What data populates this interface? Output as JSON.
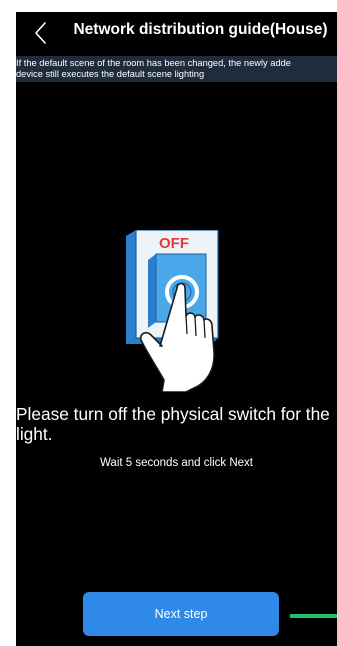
{
  "header": {
    "title": "Network distribution guide(House)",
    "back_icon": "chevron-left-icon"
  },
  "notice": {
    "line1": "If the default scene of the room has been changed, the newly adde",
    "line2": "device still executes the default scene lighting"
  },
  "illustration": {
    "switch_label": "OFF",
    "description_icon": "light-switch-off-hand-press-icon"
  },
  "instruction": {
    "main": "Please turn off the physical switch for the light.",
    "sub": "Wait 5 seconds and click Next"
  },
  "actions": {
    "next_label": "Next step"
  },
  "progress": {
    "fraction": 1.0
  },
  "colors": {
    "background": "#000000",
    "notice_bg": "#1e2c3c",
    "button": "#2e8ae6",
    "progress": "#21c068",
    "switch_face": "#4aa7ea",
    "off_text": "#e53935"
  }
}
